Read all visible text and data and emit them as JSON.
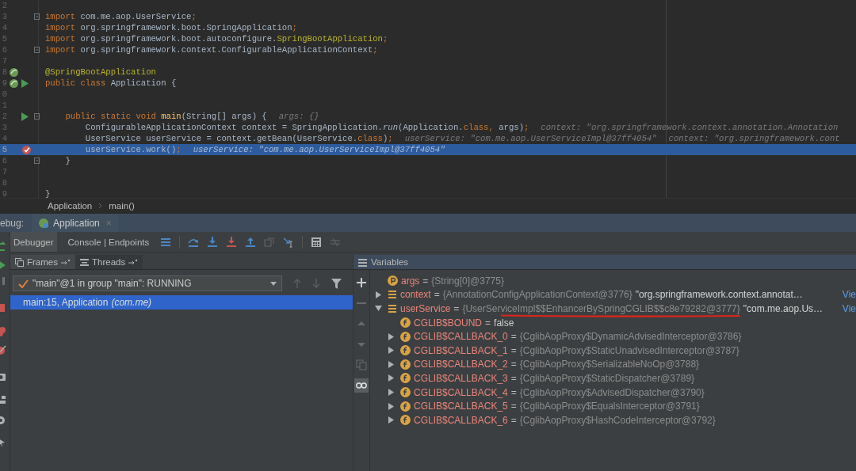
{
  "editor": {
    "lines": [
      {
        "number": "2",
        "fold": false,
        "highlighted": false
      },
      {
        "number": "3",
        "fold": true,
        "highlighted": false,
        "tokens": [
          {
            "kind": "keyword",
            "text": "import"
          },
          {
            "kind": "plain",
            "text": " com.me.aop.UserService"
          },
          {
            "kind": "keyword",
            "text": ";"
          }
        ]
      },
      {
        "number": "4",
        "fold": false,
        "highlighted": false,
        "tokens": [
          {
            "kind": "keyword",
            "text": "import"
          },
          {
            "kind": "plain",
            "text": " org.springframework.boot.SpringApplication"
          },
          {
            "kind": "keyword",
            "text": ";"
          }
        ]
      },
      {
        "number": "5",
        "fold": false,
        "highlighted": false,
        "tokens": [
          {
            "kind": "keyword",
            "text": "import"
          },
          {
            "kind": "plain",
            "text": " org.springframework.boot.autoconfigure."
          },
          {
            "kind": "annotation",
            "text": "SpringBootApplication"
          },
          {
            "kind": "keyword",
            "text": ";"
          }
        ]
      },
      {
        "number": "6",
        "fold": true,
        "highlighted": false,
        "tokens": [
          {
            "kind": "keyword",
            "text": "import"
          },
          {
            "kind": "plain",
            "text": " org.springframework.context.ConfigurableApplicationContext"
          },
          {
            "kind": "keyword",
            "text": ";"
          }
        ]
      },
      {
        "number": "7",
        "fold": false,
        "highlighted": false
      },
      {
        "number": "8",
        "gutter_icons": [
          {
            "kind": "spring"
          }
        ],
        "fold": false,
        "highlighted": false,
        "tokens": [
          {
            "kind": "annotation",
            "text": "@SpringBootApplication"
          }
        ]
      },
      {
        "number": "9",
        "gutter_icons": [
          {
            "kind": "spring"
          },
          {
            "kind": "run"
          }
        ],
        "fold": false,
        "highlighted": false,
        "tokens": [
          {
            "kind": "keyword",
            "text": "public class "
          },
          {
            "kind": "plain",
            "text": "Application {"
          }
        ]
      },
      {
        "number": "0",
        "fold": false,
        "highlighted": false
      },
      {
        "number": "1",
        "fold": false,
        "highlighted": false
      },
      {
        "number": "2",
        "gutter_icons": [
          {
            "kind": "run"
          }
        ],
        "fold": true,
        "highlighted": false,
        "tokens": [
          {
            "kind": "keyword",
            "text": "    public static void "
          },
          {
            "kind": "method",
            "text": "main"
          },
          {
            "kind": "plain",
            "text": "(String[] args) {"
          }
        ],
        "hints": [
          "args: {}"
        ]
      },
      {
        "number": "3",
        "fold": false,
        "highlighted": false,
        "tokens": [
          {
            "kind": "plain",
            "text": "        ConfigurableApplicationContext context = SpringApplication."
          },
          {
            "kind": "static",
            "text": "run"
          },
          {
            "kind": "plain",
            "text": "(Application."
          },
          {
            "kind": "keyword",
            "text": "class, "
          },
          {
            "kind": "plain",
            "text": "args)"
          },
          {
            "kind": "keyword",
            "text": ";"
          }
        ],
        "hints": [
          "context: \"org.springframework.context.annotation.Annotation"
        ]
      },
      {
        "number": "4",
        "fold": false,
        "highlighted": false,
        "tokens": [
          {
            "kind": "plain",
            "text": "        UserService userService = context.getBean(UserService."
          },
          {
            "kind": "keyword",
            "text": "class"
          },
          {
            "kind": "plain",
            "text": ")"
          },
          {
            "kind": "keyword",
            "text": ";"
          }
        ],
        "hints": [
          "userService: \"com.me.aop.UserServiceImpl@37ff4054\"",
          "context: \"org.springframework.cont"
        ]
      },
      {
        "number": "5",
        "gutter_icons": [
          {
            "kind": "breakpoint"
          }
        ],
        "fold": false,
        "highlighted": true,
        "tokens": [
          {
            "kind": "plain",
            "text": "        userService.work()"
          },
          {
            "kind": "keyword",
            "text": ";"
          }
        ],
        "hints": [
          "userService: \"com.me.aop.UserServiceImpl@37ff4054\""
        ]
      },
      {
        "number": "6",
        "fold": true,
        "highlighted": false,
        "tokens": [
          {
            "kind": "plain",
            "text": "    }"
          }
        ]
      },
      {
        "number": "7",
        "fold": false,
        "highlighted": false
      },
      {
        "number": "8",
        "fold": false,
        "highlighted": false
      },
      {
        "number": "9",
        "fold": false,
        "highlighted": false,
        "tokens": [
          {
            "kind": "plain",
            "text": "}"
          }
        ]
      }
    ]
  },
  "breadcrumbs": [
    "Application",
    "main()"
  ],
  "debug_bar": {
    "label": "ebug:",
    "tab": "Application",
    "close": "×"
  },
  "toolbar": {
    "tabs": [
      {
        "label": "Debugger",
        "selected": true
      },
      {
        "label": "Console | Endpoints",
        "selected": false
      }
    ],
    "buttons": [
      {
        "kind": "lines",
        "disabled": false
      },
      {
        "kind": "step-over",
        "disabled": false
      },
      {
        "kind": "step-into",
        "disabled": false
      },
      {
        "kind": "force-step-into",
        "disabled": false
      },
      {
        "kind": "step-out",
        "disabled": false
      },
      {
        "kind": "drop-frame",
        "disabled": true
      },
      {
        "kind": "run-to-cursor",
        "disabled": false
      },
      {
        "kind": "evaluate",
        "disabled": false
      },
      {
        "kind": "trace",
        "disabled": true
      }
    ]
  },
  "frames": {
    "tabs": [
      {
        "label": "Frames",
        "selected": true
      },
      {
        "label": "Threads",
        "selected": false
      }
    ],
    "thread": "\"main\"@1 in group \"main\": RUNNING",
    "items": [
      {
        "method": "main:15, Application",
        "package": "(com.me)",
        "selected": true
      }
    ]
  },
  "variables": {
    "title": "Variables",
    "side_buttons": [
      {
        "kind": "add",
        "disabled": false,
        "selected": false
      },
      {
        "kind": "remove",
        "disabled": true,
        "selected": false
      },
      {
        "kind": "up",
        "disabled": true,
        "selected": false
      },
      {
        "kind": "down",
        "disabled": true,
        "selected": false
      },
      {
        "kind": "copy",
        "disabled": true,
        "selected": false
      },
      {
        "kind": "glasses",
        "disabled": false,
        "selected": true
      }
    ],
    "items": [
      {
        "kind": "parameter",
        "name": "args",
        "operator": "=",
        "value": "{String[0]@3775}"
      },
      {
        "kind": "object",
        "name": "context",
        "expanded": false,
        "operator": "=",
        "value": "{AnnotationConfigApplicationContext@3776}",
        "text": "\"org.springframework.context.annotat…",
        "link": "Vie"
      },
      {
        "kind": "object",
        "name": "userService",
        "expanded": true,
        "operator": "=",
        "value": "{UserServiceImpl$$EnhancerBySpringCGLIB$$c8e79282@3777}",
        "underlined": true,
        "text": "\"com.me.aop.Us…",
        "link": "Vie",
        "children": [
          {
            "kind": "field",
            "name": "CGLIB$BOUND",
            "operator": "=",
            "value": "false"
          },
          {
            "kind": "field",
            "name": "CGLIB$CALLBACK_0",
            "expanded": false,
            "operator": "=",
            "value": "{CglibAopProxy$DynamicAdvisedInterceptor@3786}"
          },
          {
            "kind": "field",
            "name": "CGLIB$CALLBACK_1",
            "expanded": false,
            "operator": "=",
            "value": "{CglibAopProxy$StaticUnadvisedInterceptor@3787}"
          },
          {
            "kind": "field",
            "name": "CGLIB$CALLBACK_2",
            "expanded": false,
            "operator": "=",
            "value": "{CglibAopProxy$SerializableNoOp@3788}"
          },
          {
            "kind": "field",
            "name": "CGLIB$CALLBACK_3",
            "expanded": false,
            "operator": "=",
            "value": "{CglibAopProxy$StaticDispatcher@3789}"
          },
          {
            "kind": "field",
            "name": "CGLIB$CALLBACK_4",
            "expanded": false,
            "operator": "=",
            "value": "{CglibAopProxy$AdvisedDispatcher@3790}"
          },
          {
            "kind": "field",
            "name": "CGLIB$CALLBACK_5",
            "expanded": false,
            "operator": "=",
            "value": "{CglibAopProxy$EqualsInterceptor@3791}"
          },
          {
            "kind": "field",
            "name": "CGLIB$CALLBACK_6",
            "expanded": false,
            "operator": "=",
            "value": "{CglibAopProxy$HashCodeInterceptor@3792}"
          }
        ]
      }
    ]
  }
}
